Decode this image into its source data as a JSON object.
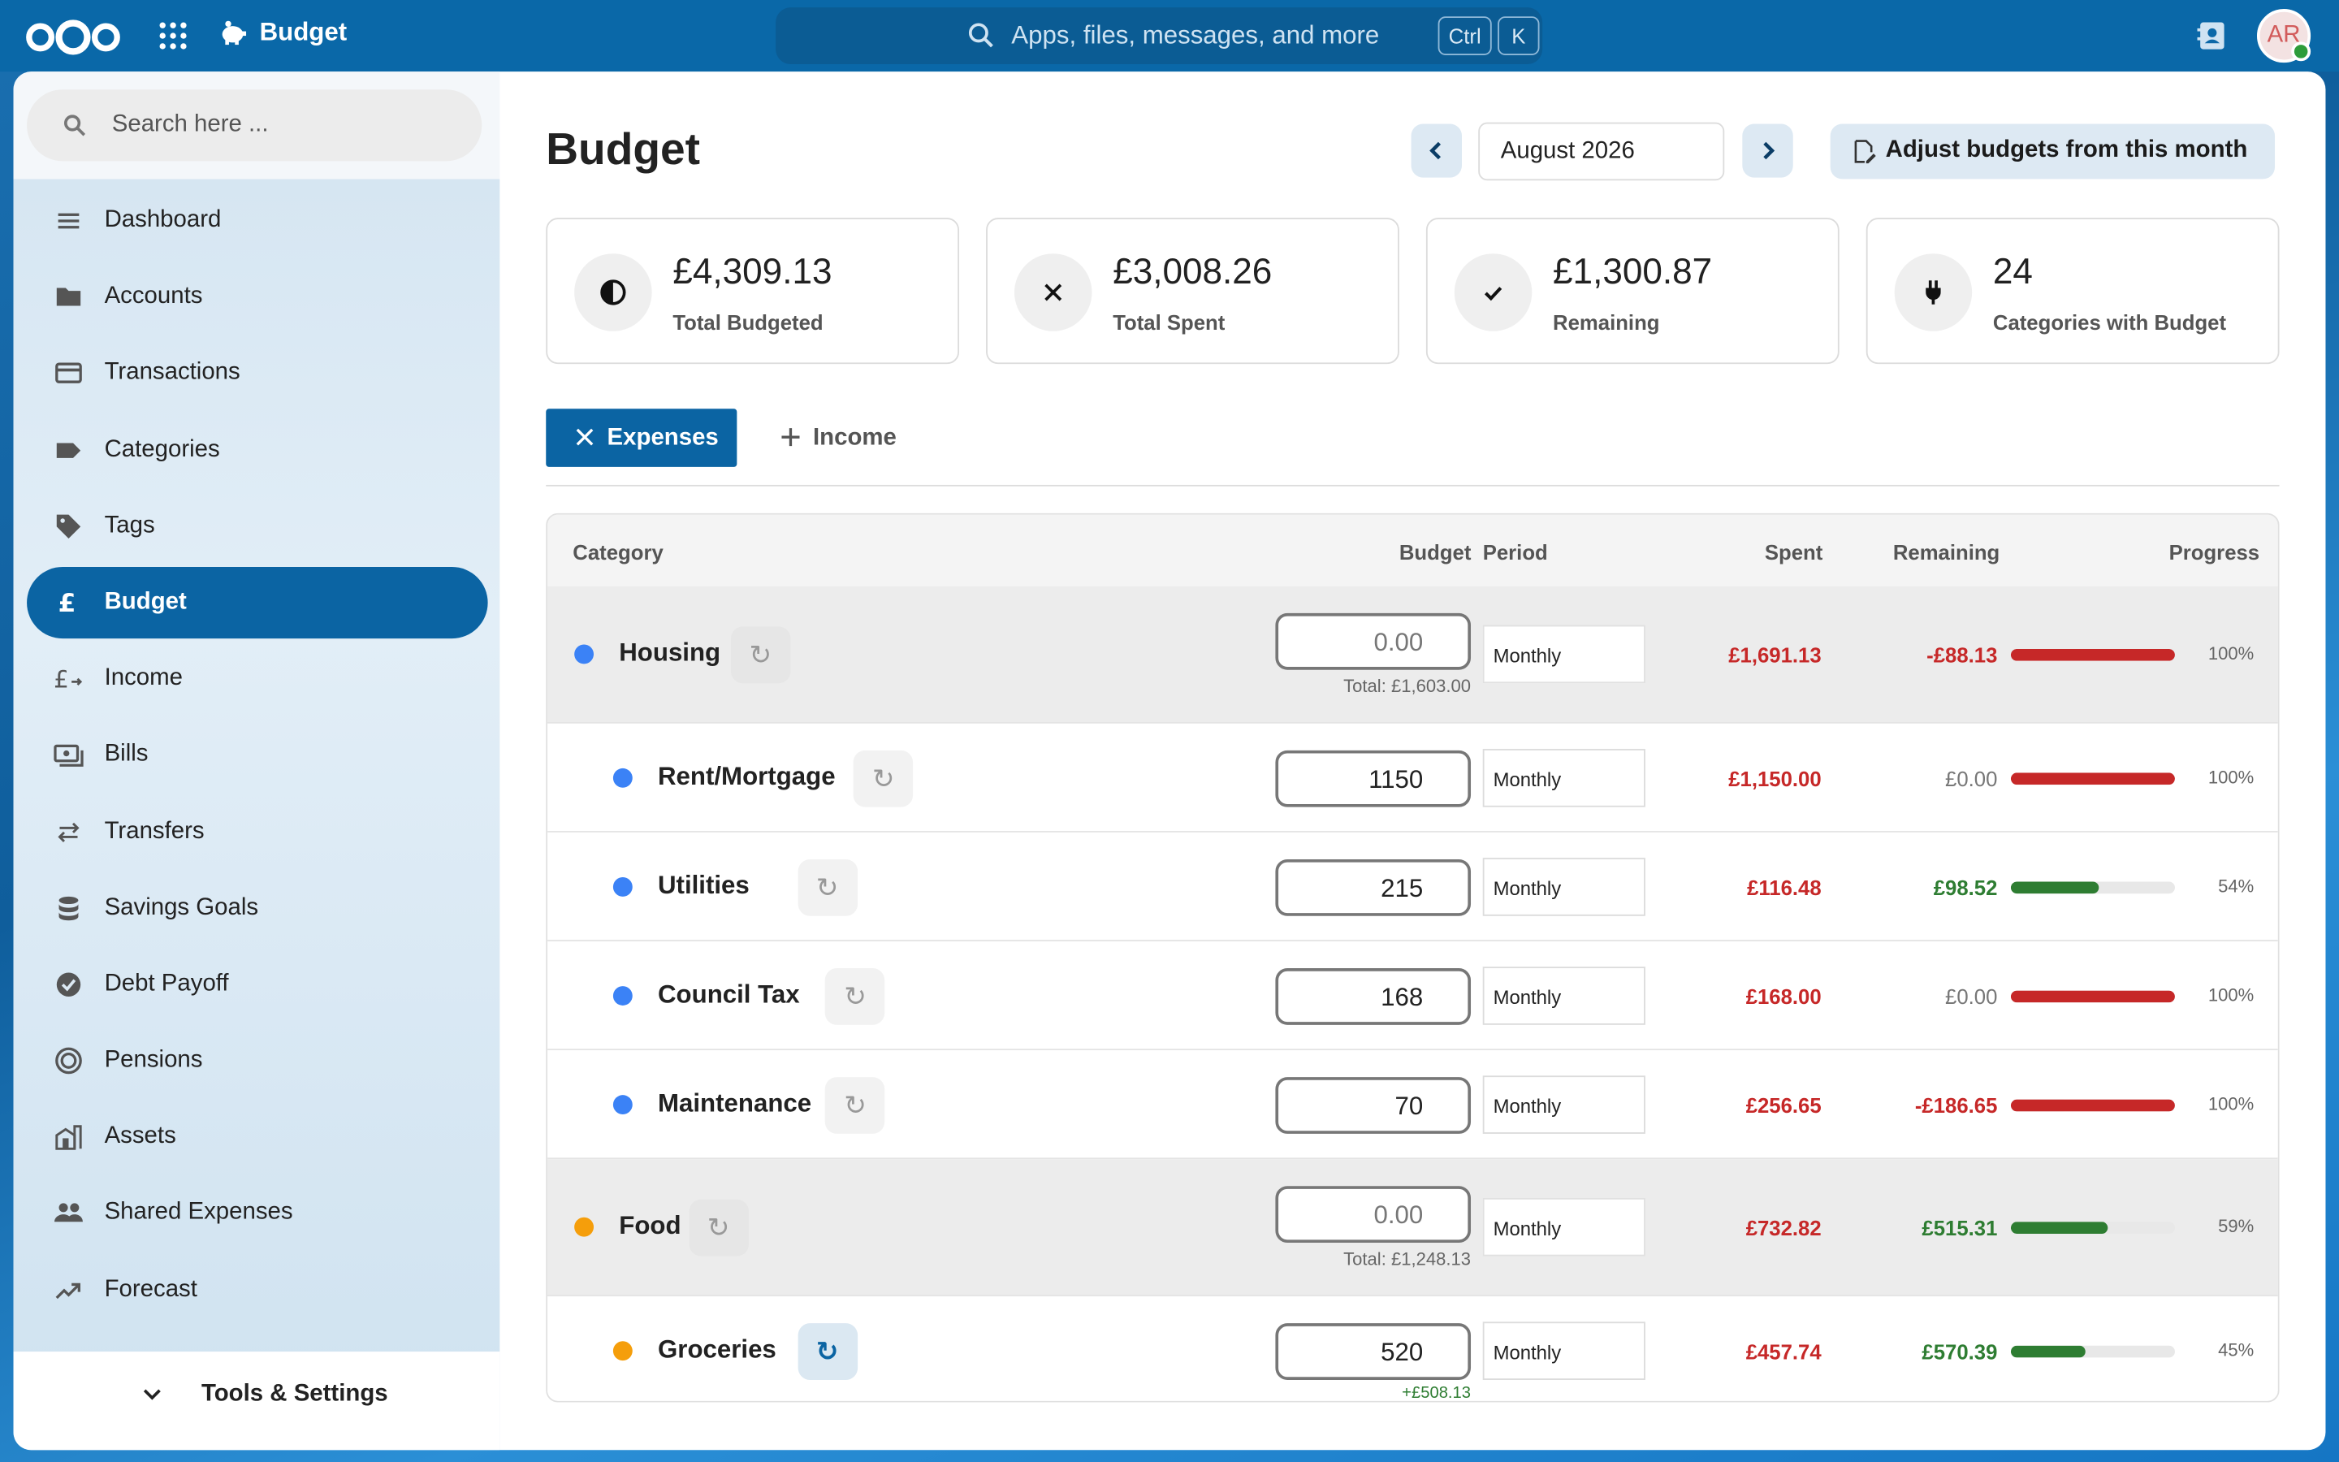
{
  "topbar": {
    "app_name": "Budget",
    "search_placeholder": "Apps, files, messages, and more",
    "shortcut_ctrl": "Ctrl",
    "shortcut_key": "K",
    "avatar_initials": "AR"
  },
  "sidebar": {
    "search_placeholder": "Search here ...",
    "items": [
      {
        "label": "Dashboard",
        "icon": "menu-icon"
      },
      {
        "label": "Accounts",
        "icon": "folder-icon"
      },
      {
        "label": "Transactions",
        "icon": "credit-card-icon"
      },
      {
        "label": "Categories",
        "icon": "label-icon"
      },
      {
        "label": "Tags",
        "icon": "tag-icon"
      },
      {
        "label": "Budget",
        "icon": "pound-icon",
        "active": true
      },
      {
        "label": "Income",
        "icon": "pound-arrow-icon"
      },
      {
        "label": "Bills",
        "icon": "bill-icon"
      },
      {
        "label": "Transfers",
        "icon": "transfer-icon"
      },
      {
        "label": "Savings Goals",
        "icon": "database-icon"
      },
      {
        "label": "Debt Payoff",
        "icon": "check-circle-icon"
      },
      {
        "label": "Pensions",
        "icon": "target-icon"
      },
      {
        "label": "Assets",
        "icon": "building-icon"
      },
      {
        "label": "Shared Expenses",
        "icon": "people-icon"
      },
      {
        "label": "Forecast",
        "icon": "trending-up-icon"
      }
    ],
    "footer_label": "Tools & Settings"
  },
  "page": {
    "title": "Budget",
    "month": "August 2026",
    "adjust_button": "Adjust budgets from this month"
  },
  "stats": [
    {
      "value": "£4,309.13",
      "caption": "Total Budgeted",
      "icon": "pie-icon"
    },
    {
      "value": "£3,008.26",
      "caption": "Total Spent",
      "icon": "close-icon"
    },
    {
      "value": "£1,300.87",
      "caption": "Remaining",
      "icon": "check-icon"
    },
    {
      "value": "24",
      "caption": "Categories with Budget",
      "icon": "plug-icon"
    }
  ],
  "tabs": {
    "expenses": "Expenses",
    "income": "Income"
  },
  "table": {
    "headers": {
      "category": "Category",
      "budget": "Budget",
      "period": "Period",
      "spent": "Spent",
      "remaining": "Remaining",
      "progress": "Progress"
    },
    "rows": [
      {
        "type": "parent",
        "name": "Housing",
        "color": "#3b82f6",
        "budget": "0.00",
        "total": "Total: £1,603.00",
        "period": "Monthly",
        "spent": "£1,691.13",
        "remaining": "-£88.13",
        "remaining_state": "neg",
        "progress": 1.0,
        "progress_color": "red",
        "pct": "100%"
      },
      {
        "type": "child",
        "name": "Rent/Mortgage",
        "color": "#3b82f6",
        "budget": "1150",
        "period": "Monthly",
        "spent": "£1,150.00",
        "remaining": "£0.00",
        "remaining_state": "zero",
        "progress": 1.0,
        "progress_color": "red",
        "pct": "100%"
      },
      {
        "type": "child",
        "name": "Utilities",
        "color": "#3b82f6",
        "budget": "215",
        "period": "Monthly",
        "spent": "£116.48",
        "remaining": "£98.52",
        "remaining_state": "pos",
        "progress": 0.54,
        "progress_color": "green",
        "pct": "54%"
      },
      {
        "type": "child",
        "name": "Council Tax",
        "color": "#3b82f6",
        "budget": "168",
        "period": "Monthly",
        "spent": "£168.00",
        "remaining": "£0.00",
        "remaining_state": "zero",
        "progress": 1.0,
        "progress_color": "red",
        "pct": "100%"
      },
      {
        "type": "child",
        "name": "Maintenance",
        "color": "#3b82f6",
        "budget": "70",
        "period": "Monthly",
        "spent": "£256.65",
        "remaining": "-£186.65",
        "remaining_state": "neg",
        "progress": 1.0,
        "progress_color": "red",
        "pct": "100%"
      },
      {
        "type": "parent",
        "name": "Food",
        "color": "#f59e0b",
        "budget": "0.00",
        "total": "Total: £1,248.13",
        "period": "Monthly",
        "spent": "£732.82",
        "remaining": "£515.31",
        "remaining_state": "pos",
        "progress": 0.59,
        "progress_color": "green",
        "pct": "59%"
      },
      {
        "type": "child",
        "name": "Groceries",
        "color": "#f59e0b",
        "budget": "520",
        "total": "+£508.13",
        "total_state": "pos",
        "period": "Monthly",
        "spent": "£457.74",
        "remaining": "£570.39",
        "remaining_state": "pos",
        "progress": 0.45,
        "progress_color": "green",
        "pct": "45%",
        "refresh_active": true
      }
    ]
  }
}
